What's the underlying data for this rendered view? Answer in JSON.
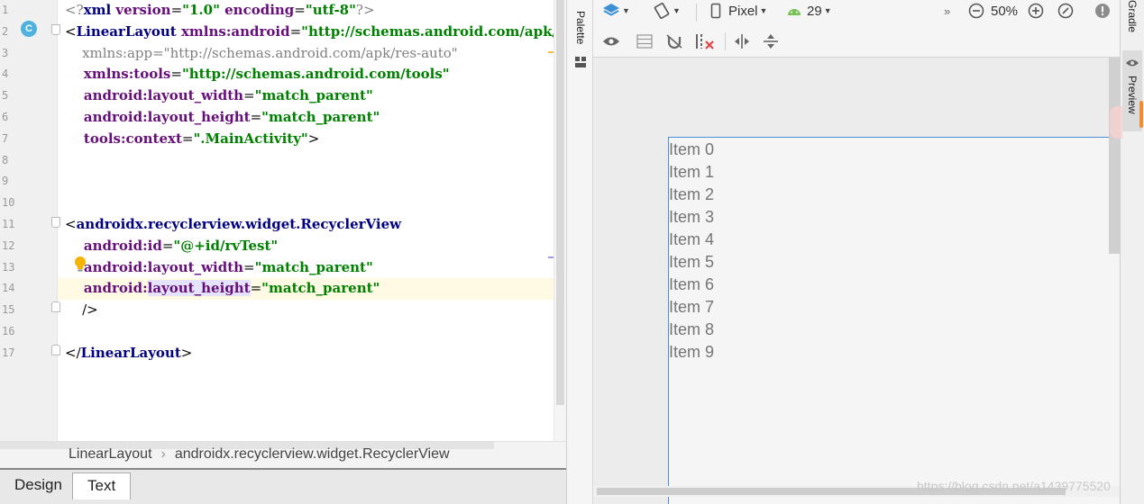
{
  "editor": {
    "line_numbers": [
      "1",
      "2",
      "3",
      "4",
      "5",
      "6",
      "7",
      "8",
      "9",
      "10",
      "11",
      "12",
      "13",
      "14",
      "15",
      "16",
      "17"
    ],
    "lines": [
      [
        {
          "t": "<?",
          "c": "c-gray"
        },
        {
          "t": "xml ",
          "c": "c-tag"
        },
        {
          "t": "version",
          "c": "c-attr"
        },
        {
          "t": "=",
          "c": "c-plain"
        },
        {
          "t": "\"1.0\"",
          "c": "c-val"
        },
        {
          "t": " encoding",
          "c": "c-attr"
        },
        {
          "t": "=",
          "c": "c-plain"
        },
        {
          "t": "\"utf-8\"",
          "c": "c-val"
        },
        {
          "t": "?>",
          "c": "c-gray"
        }
      ],
      [
        {
          "t": "<",
          "c": "c-plain"
        },
        {
          "t": "LinearLayout ",
          "c": "c-tag"
        },
        {
          "t": "xmlns:android",
          "c": "c-ns"
        },
        {
          "t": "=",
          "c": "c-plain"
        },
        {
          "t": "\"http://schemas.android.com/apk/res/andro",
          "c": "c-val"
        }
      ],
      [
        {
          "t": "    xmlns:app=\"http://schemas.android.com/apk/res-auto\"",
          "c": "c-gray"
        }
      ],
      [
        {
          "t": "    xmlns:tools",
          "c": "c-ns"
        },
        {
          "t": "=",
          "c": "c-plain"
        },
        {
          "t": "\"http://schemas.android.com/tools\"",
          "c": "c-val"
        }
      ],
      [
        {
          "t": "    android:layout_width",
          "c": "c-attr"
        },
        {
          "t": "=",
          "c": "c-plain"
        },
        {
          "t": "\"match_parent\"",
          "c": "c-val"
        }
      ],
      [
        {
          "t": "    android:layout_height",
          "c": "c-attr"
        },
        {
          "t": "=",
          "c": "c-plain"
        },
        {
          "t": "\"match_parent\"",
          "c": "c-val"
        }
      ],
      [
        {
          "t": "    tools:context",
          "c": "c-attr"
        },
        {
          "t": "=",
          "c": "c-plain"
        },
        {
          "t": "\".MainActivity\"",
          "c": "c-val"
        },
        {
          "t": ">",
          "c": "c-plain"
        }
      ],
      [],
      [],
      [],
      [
        {
          "t": "<",
          "c": "c-plain"
        },
        {
          "t": "androidx.recyclerview.widget.RecyclerView",
          "c": "c-tag"
        }
      ],
      [
        {
          "t": "    android:id",
          "c": "c-attr"
        },
        {
          "t": "=",
          "c": "c-plain"
        },
        {
          "t": "\"@+id/rvTest\"",
          "c": "c-val"
        }
      ],
      [
        {
          "t": "    android:layout_width",
          "c": "c-attr"
        },
        {
          "t": "=",
          "c": "c-plain"
        },
        {
          "t": "\"match_parent\"",
          "c": "c-val"
        }
      ],
      [
        {
          "t": "    android:",
          "c": "c-attr"
        },
        {
          "t": "layout_height",
          "c": "c-attr c-sel"
        },
        {
          "t": "=",
          "c": "c-plain"
        },
        {
          "t": "\"match_parent\"",
          "c": "c-val"
        }
      ],
      [
        {
          "t": "    />",
          "c": "c-plain"
        }
      ],
      [],
      [
        {
          "t": "</",
          "c": "c-plain"
        },
        {
          "t": "LinearLayout",
          "c": "c-tag"
        },
        {
          "t": ">",
          "c": "c-plain"
        }
      ]
    ],
    "active_line_index": 13,
    "gutter_class_badge": "C"
  },
  "breadcrumb": {
    "items": [
      "LinearLayout",
      "androidx.recyclerview.widget.RecyclerView"
    ],
    "separator": "›"
  },
  "bottom_tabs": {
    "design": "Design",
    "text": "Text"
  },
  "palette": {
    "label": "Palette"
  },
  "toolbar": {
    "device": "Pixel",
    "api_level": "29",
    "zoom": "50%",
    "overflow": "»"
  },
  "preview": {
    "items": [
      "Item 0",
      "Item 1",
      "Item 2",
      "Item 3",
      "Item 4",
      "Item 5",
      "Item 6",
      "Item 7",
      "Item 8",
      "Item 9"
    ]
  },
  "side": {
    "gradle": "Gradle",
    "preview": "Preview"
  },
  "watermark": "https://blog.csdn.net/a1439775520",
  "colors": {
    "selection_border": "#4a90d9",
    "accent_orange": "#f28b34",
    "class_badge": "#4fb1de"
  }
}
